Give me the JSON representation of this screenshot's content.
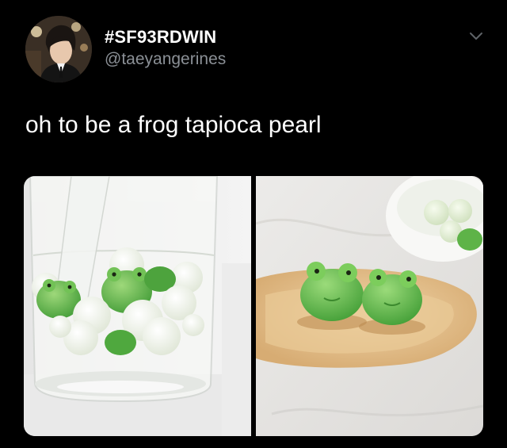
{
  "tweet": {
    "display_name": "#SF93RDWIN",
    "handle": "@taeyangerines",
    "text": "oh to be a frog tapioca pearl"
  },
  "icons": {
    "avatar": "profile-avatar",
    "menu": "chevron-down-icon"
  },
  "media": {
    "photos": [
      {
        "subject": "glass-of-water-with-frog-tapioca-pearls"
      },
      {
        "subject": "wooden-spoon-with-two-frog-tapioca-pearls"
      }
    ]
  },
  "colors": {
    "background": "#000000",
    "text_primary": "#ffffff",
    "text_secondary": "#8b9096",
    "frog_green": "#5fb84a"
  }
}
